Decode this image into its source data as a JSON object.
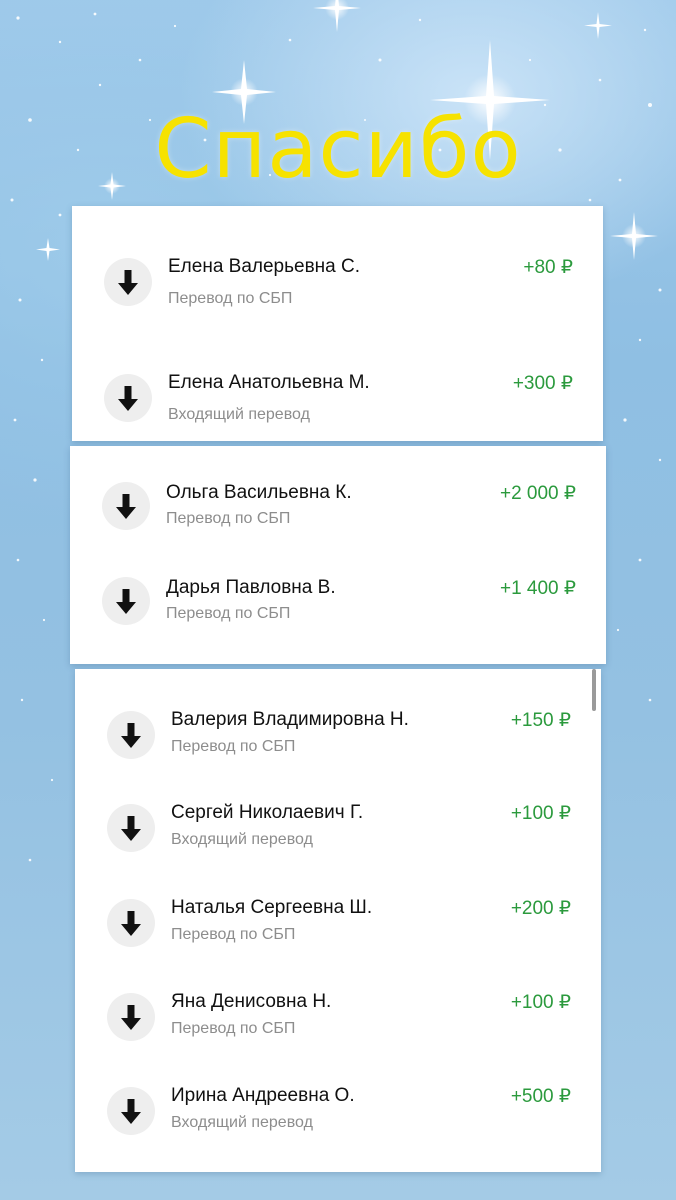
{
  "title": "Спасибо",
  "colors": {
    "title": "#f6e200",
    "amount": "#2b9a3d",
    "background": "#96c4e5"
  },
  "icon": "arrow-down-icon",
  "cards": [
    {
      "items": [
        {
          "name": "Елена Валерьевна С.",
          "type": "Перевод по СБП",
          "amount": "+80 ₽"
        },
        {
          "name": "Елена Анатольевна М.",
          "type": "Входящий перевод",
          "amount": "+300 ₽"
        }
      ]
    },
    {
      "items": [
        {
          "name": "Ольга Васильевна К.",
          "type": "Перевод по СБП",
          "amount": "+2 000 ₽"
        },
        {
          "name": "Дарья Павловна В.",
          "type": "Перевод по СБП",
          "amount": "+1 400 ₽"
        }
      ]
    },
    {
      "items": [
        {
          "name": "Валерия Владимировна Н.",
          "type": "Перевод по СБП",
          "amount": "+150 ₽"
        },
        {
          "name": "Сергей Николаевич Г.",
          "type": "Входящий перевод",
          "amount": "+100 ₽"
        },
        {
          "name": "Наталья Сергеевна Ш.",
          "type": "Перевод по СБП",
          "amount": "+200 ₽"
        },
        {
          "name": "Яна Денисовна Н.",
          "type": "Перевод по СБП",
          "amount": "+100 ₽"
        },
        {
          "name": "Ирина Андреевна О.",
          "type": "Входящий перевод",
          "amount": "+500 ₽"
        }
      ]
    }
  ]
}
